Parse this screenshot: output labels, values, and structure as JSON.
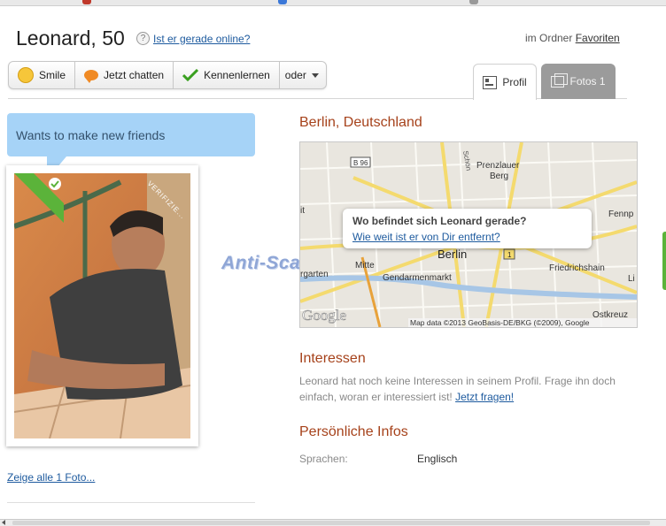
{
  "header": {
    "name": "Leonard, 50",
    "online_link": "Ist er gerade online?",
    "folder_prefix": "im Ordner",
    "folder_link": "Favoriten"
  },
  "actions": {
    "smile": "Smile",
    "chat": "Jetzt chatten",
    "meet": "Kennenlernen",
    "more": "oder"
  },
  "tabs": {
    "profile": "Profil",
    "photos": "Fotos 1"
  },
  "status_bubble": "Wants to make new friends",
  "photo": {
    "badge": "VERIFIZIE...",
    "show_all": "Zeige alle 1 Foto..."
  },
  "watermark": "Anti-Scam-Forum-Nl",
  "location": {
    "title": "Berlin, Deutschland",
    "popup_title": "Wo befindet sich Leonard gerade?",
    "popup_link": "Wie weit ist er von Dir entfernt?",
    "map_labels": {
      "b96": "B 96",
      "prenzlauer": "Prenzlauer",
      "berg": "Berg",
      "schon": "Schön",
      "fenn": "Fennp",
      "berlin": "Berlin",
      "mitte": "Mitte",
      "gendarmen": "Gendarmenmarkt",
      "friedrichshain": "Friedrichshain",
      "garten": "rgarten",
      "ostkreuz": "Ostkreuz",
      "it": "it",
      "li": "Li",
      "one": "1",
      "mapdata": "Map data ©2013 GeoBasis-DE/BKG (©2009), Google",
      "google": "Google"
    }
  },
  "interests": {
    "title": "Interessen",
    "text": "Leonard hat noch keine Interessen in seinem Profil. Frage ihn doch einfach, woran er interessiert ist!",
    "link": "Jetzt fragen!"
  },
  "personal": {
    "title": "Persönliche Infos",
    "language_label": "Sprachen:",
    "language_value": "Englisch"
  },
  "colors": {
    "heading": "#a6421b",
    "link": "#1d5a9e",
    "bubble": "#a6d3f7",
    "verified": "#5bb33a"
  }
}
